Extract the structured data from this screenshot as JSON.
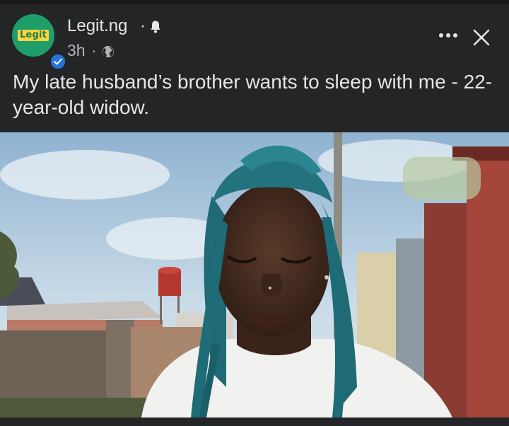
{
  "post": {
    "page_name": "Legit.ng",
    "name_separator": "·",
    "timestamp": "3h",
    "time_separator": "·",
    "avatar_text": "Legit",
    "caption": "My late husband’s brother wants to sleep with me - 22-year-old widow."
  },
  "icons": {
    "bell": "bell-icon",
    "globe": "globe-icon",
    "more": "more-options-icon",
    "close": "close-icon",
    "verified": "verified-badge-icon"
  },
  "colors": {
    "background": "#242526",
    "text": "#e4e6eb",
    "secondary_text": "#b0b3b8",
    "verified_blue": "#2374e1",
    "avatar_green": "#1f9e6a",
    "avatar_yellow": "#fcd43b"
  }
}
